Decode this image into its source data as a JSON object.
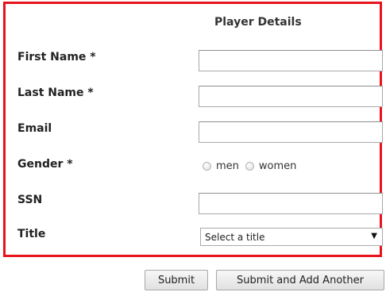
{
  "form": {
    "title": "Player Details",
    "fields": {
      "first_name": {
        "label": "First Name *",
        "value": ""
      },
      "last_name": {
        "label": "Last Name *",
        "value": ""
      },
      "email": {
        "label": "Email",
        "value": ""
      },
      "gender": {
        "label": "Gender *",
        "options": [
          "men",
          "women"
        ],
        "selected": null
      },
      "ssn": {
        "label": "SSN",
        "value": ""
      },
      "title": {
        "label": "Title",
        "selected_text": "Select a title"
      }
    },
    "buttons": {
      "submit": "Submit",
      "submit_add_another": "Submit and Add Another"
    }
  },
  "colors": {
    "frame_border": "#e8141c"
  },
  "icons": {
    "select_caret": "caret-down-icon"
  }
}
